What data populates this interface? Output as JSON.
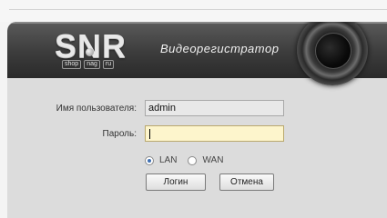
{
  "header": {
    "logo_text": "SNR",
    "logo_sub": [
      "shop",
      "nag",
      "ru"
    ],
    "product_title": "Видеорегистратор"
  },
  "login_form": {
    "username_label": "Имя пользователя:",
    "username_value": "admin",
    "password_label": "Пароль:",
    "password_value": "",
    "network_options": [
      {
        "label": "LAN",
        "selected": true
      },
      {
        "label": "WAN",
        "selected": false
      }
    ],
    "login_button": "Логин",
    "cancel_button": "Отмена"
  },
  "colors": {
    "banner": "#3c3c3c",
    "panel": "#dcdcdc",
    "password_field": "#fdf5cc",
    "radio_selected": "#3f6fb2"
  },
  "icons": {
    "camera": "camera-lens-icon",
    "radio_on": "radio-selected-icon",
    "radio_off": "radio-unselected-icon"
  }
}
